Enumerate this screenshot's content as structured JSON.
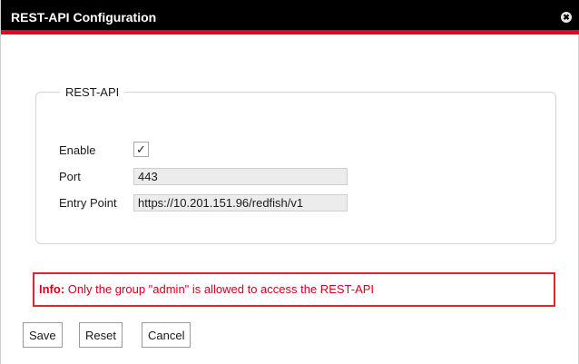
{
  "dialog": {
    "title": "REST-API Configuration",
    "close_glyph": "✖",
    "accent_color": "#e8002d"
  },
  "fieldset": {
    "legend": "REST-API",
    "enable_label": "Enable",
    "enable_checked": true,
    "check_glyph": "✓",
    "port_label": "Port",
    "port_value": "443",
    "entry_point_label": "Entry Point",
    "entry_point_value": "https://10.201.151.96/redfish/v1"
  },
  "info": {
    "prefix": "Info:",
    "message": " Only the group \"admin\" is allowed to access the REST-API"
  },
  "buttons": {
    "save": "Save",
    "reset": "Reset",
    "cancel": "Cancel"
  }
}
